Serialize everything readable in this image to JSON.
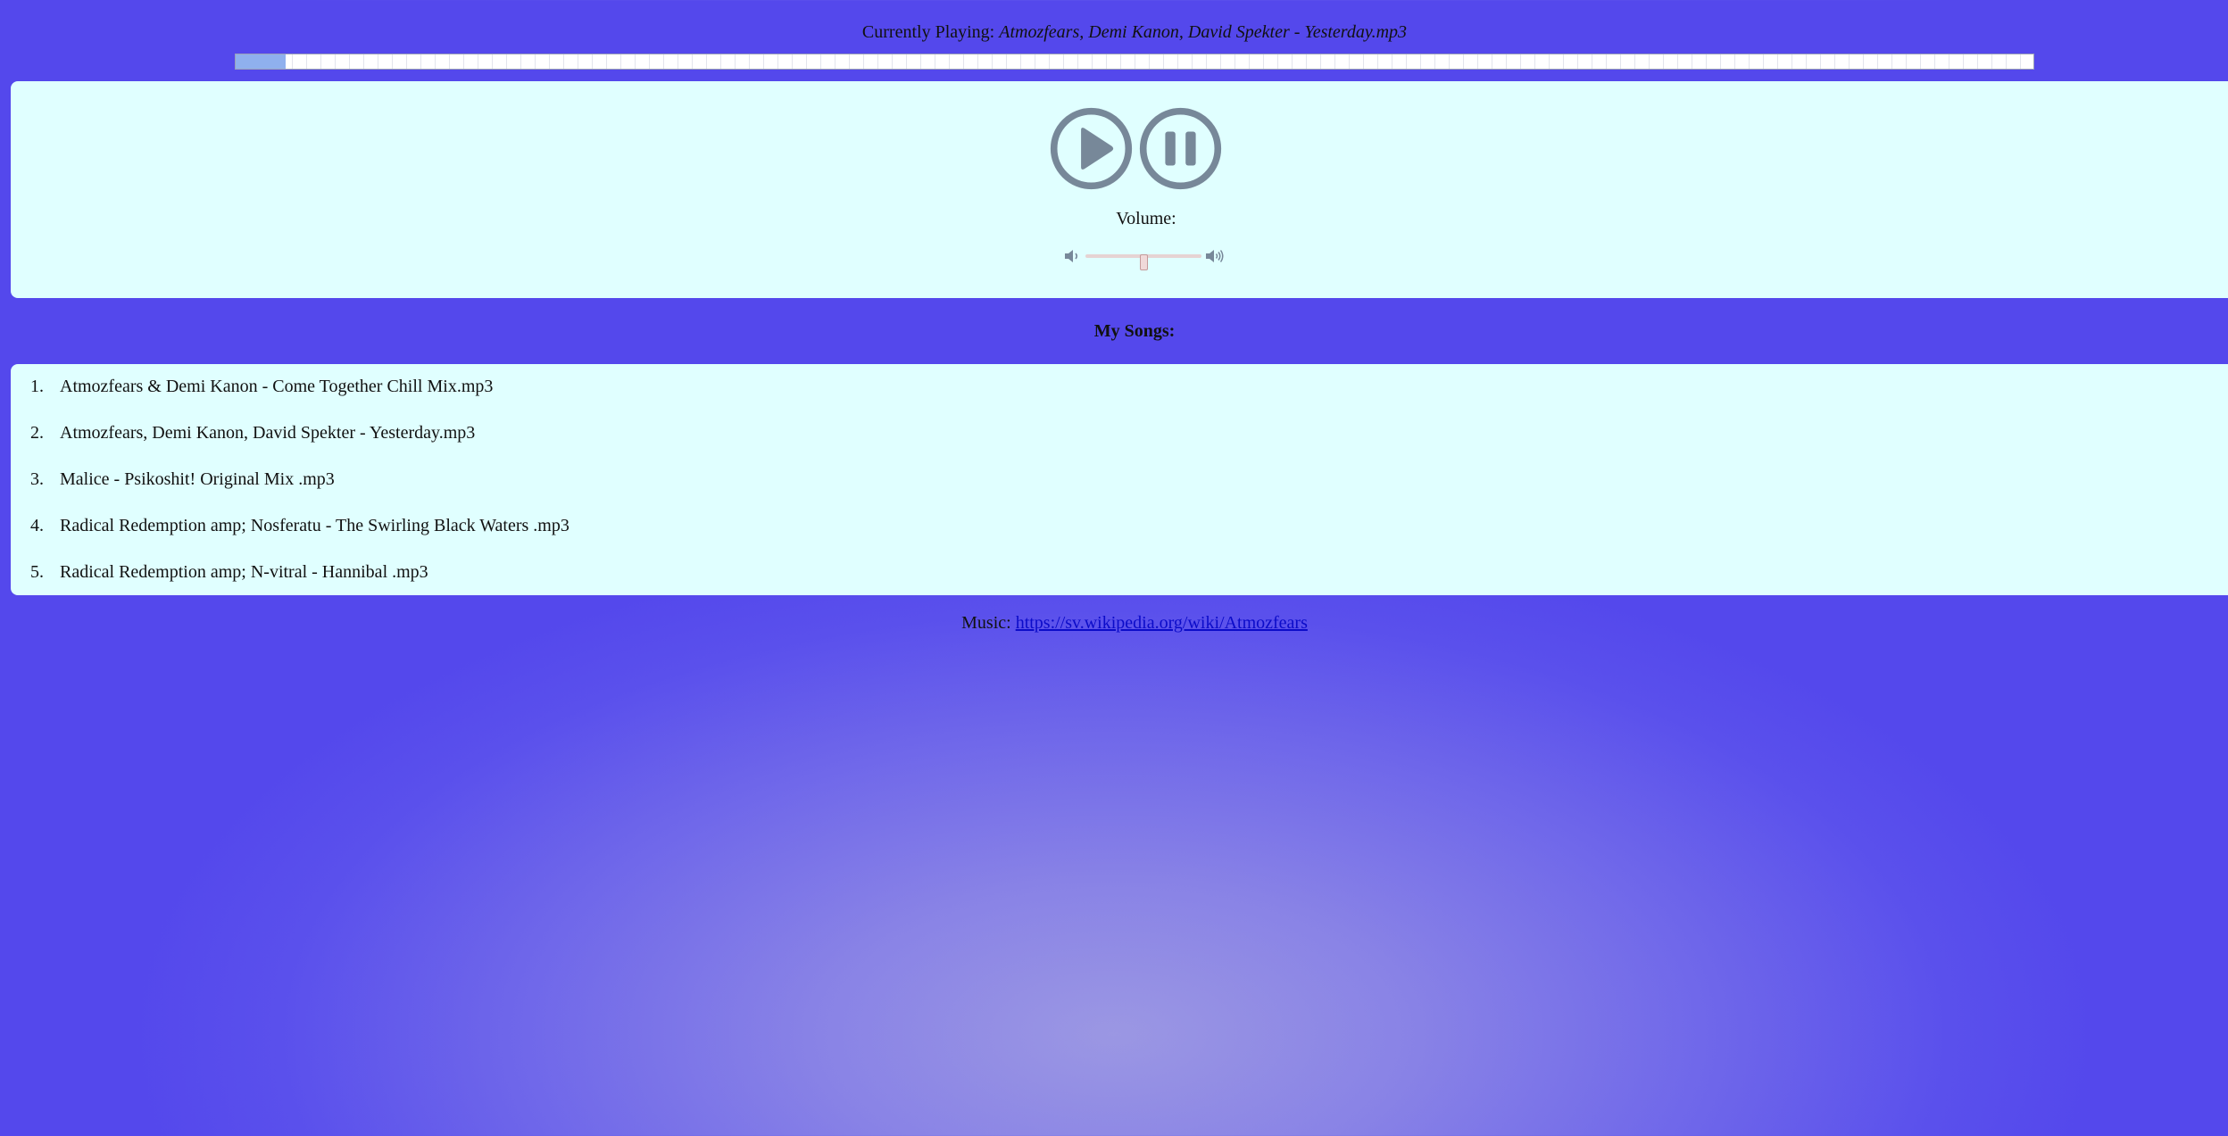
{
  "now_playing": {
    "prefix": "Currently Playing:",
    "track": "Atmozfears, Demi Kanon, David Spekter - Yesterday.mp3",
    "progress_fraction": 0.028
  },
  "controls": {
    "play_icon": "play-icon",
    "pause_icon": "pause-icon",
    "volume_label": "Volume:",
    "volume_value": 0.5,
    "volume_low_icon": "volume-low-icon",
    "volume_high_icon": "volume-high-icon"
  },
  "songs": {
    "heading": "My Songs:",
    "items": [
      {
        "num": "1.",
        "title": "Atmozfears & Demi Kanon - Come Together Chill Mix.mp3"
      },
      {
        "num": "2.",
        "title": "Atmozfears, Demi Kanon, David Spekter - Yesterday.mp3"
      },
      {
        "num": "3.",
        "title": "Malice - Psikoshit! Original Mix .mp3"
      },
      {
        "num": "4.",
        "title": "Radical Redemption amp; Nosferatu - The Swirling Black Waters .mp3"
      },
      {
        "num": "5.",
        "title": "Radical Redemption amp; N-vitral - Hannibal .mp3"
      }
    ]
  },
  "credits": {
    "prefix": "Music:",
    "link_text": "https://sv.wikipedia.org/wiki/Atmozfears"
  },
  "colors": {
    "background": "#5448ec",
    "panel": "#e0ffff",
    "progress_fill": "#8fb0ee",
    "icon": "#778899",
    "link": "#0b0bc9"
  }
}
